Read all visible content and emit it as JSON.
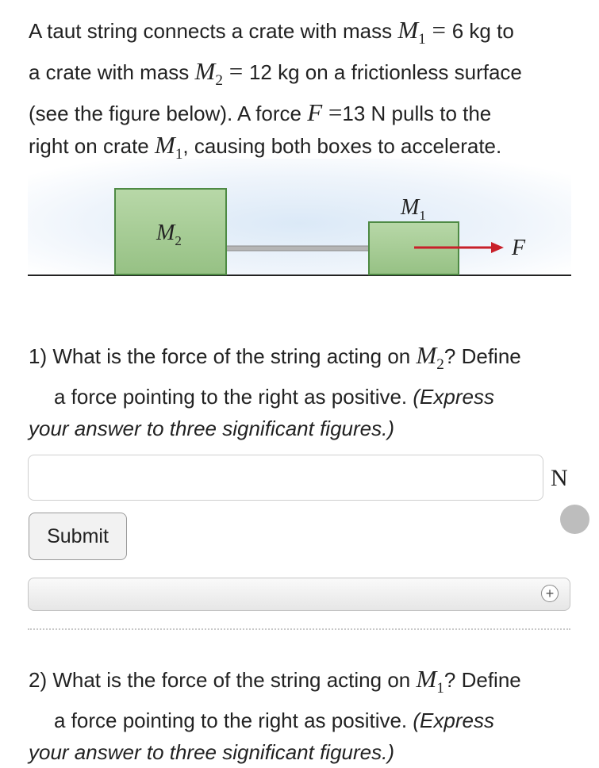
{
  "problem": {
    "line1_pre": "A taut string connects a crate with mass ",
    "m1_sym": "M",
    "m1_sub": "1",
    "eq1": " = ",
    "m1_val": "6 kg to",
    "line2_pre": "a crate with mass ",
    "m2_sym": "M",
    "m2_sub": "2",
    "eq2": " = ",
    "line2_post": "12 kg on a frictionless surface",
    "line3_pre": "(see the figure below). A force ",
    "f_sym": "F",
    "eq3": " =",
    "line3_post": "13 N pulls to the",
    "line4_pre": "right on crate ",
    "m1b_sym": "M",
    "m1b_sub": "1",
    "line4_post": ", causing both boxes to accelerate."
  },
  "figure": {
    "m2_label": "M",
    "m2_sub": "2",
    "m1_label": "M",
    "m1_sub": "1",
    "force_label": "F",
    "colors": {
      "crate_fill": "#a9cf9a",
      "crate_border": "#4e8a44",
      "arrow": "#c8202a"
    }
  },
  "q1": {
    "num": "1) What is the force of the string acting on ",
    "sym": "M",
    "sub": "2",
    "post": "? Define",
    "cont": "a force pointing to the right as positive. ",
    "express1": "(Express",
    "express2": "your answer to three significant figures.)"
  },
  "answer": {
    "value": "",
    "unit": "N"
  },
  "submit_label": "Submit",
  "hint_icon": "plus-icon",
  "q2": {
    "num": "2) What is the force of the string acting on ",
    "sym": "M",
    "sub": "1",
    "post": "? Define",
    "cont": "a force pointing to the right as positive. ",
    "express1": "(Express",
    "express2": "your answer to three significant figures.)"
  }
}
